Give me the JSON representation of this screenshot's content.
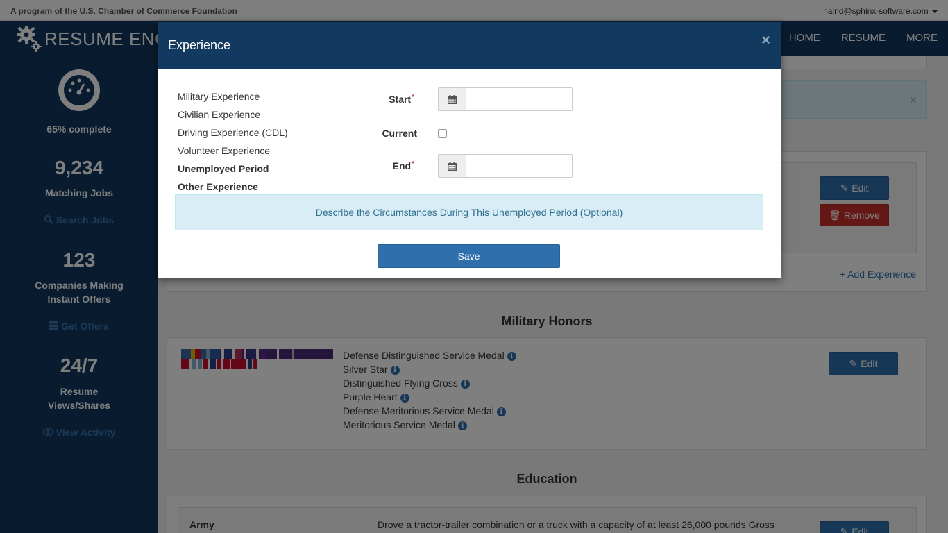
{
  "topbar": {
    "program": "A program of the U.S. Chamber of Commerce Foundation",
    "user": "haind@sphinx-software.com"
  },
  "header": {
    "brand": "RESUME ENG",
    "nav": [
      "HOME",
      "RESUME",
      "MORE"
    ]
  },
  "sidebar": {
    "complete": "65% complete",
    "matching_count": "9,234",
    "matching_label": "Matching Jobs",
    "search_link": "Search Jobs",
    "companies_count": "123",
    "companies_label_1": "Companies Making",
    "companies_label_2": "Instant Offers",
    "offers_link": "Get Offers",
    "views_count": "24/7",
    "views_label_1": "Resume",
    "views_label_2": "Views/Shares",
    "activity_link": "View Activity"
  },
  "main": {
    "edit_label": "Edit",
    "remove_label": "Remove",
    "add_experience": "+ Add Experience",
    "honors_title": "Military Honors",
    "honors": [
      "Defense Distinguished Service Medal",
      "Silver Star",
      "Distinguished Flying Cross",
      "Purple Heart",
      "Defense Meritorious Service Medal",
      "Meritorious Service Medal"
    ],
    "education_title": "Education",
    "education_org": "Army",
    "education_desc": "Drove a tractor-trailer combination or a truck with a capacity of at least 26,000 pounds Gross"
  },
  "modal": {
    "title": "Experience",
    "close": "×",
    "experience_types": [
      "Military Experience",
      "Civilian Experience",
      "Driving Experience (CDL)",
      "Volunteer Experience",
      "Unemployed Period",
      "Other Experience"
    ],
    "start_label": "Start",
    "current_label": "Current",
    "end_label": "End",
    "required_mark": "*",
    "start_value": "",
    "end_value": "",
    "describe_label": "Describe the Circumstances During This Unemployed Period (Optional)",
    "save_label": "Save"
  },
  "colors": {
    "navy": "#12395f",
    "primary": "#2f6fac",
    "danger": "#c9302c",
    "info_bg": "#d9edf7"
  }
}
